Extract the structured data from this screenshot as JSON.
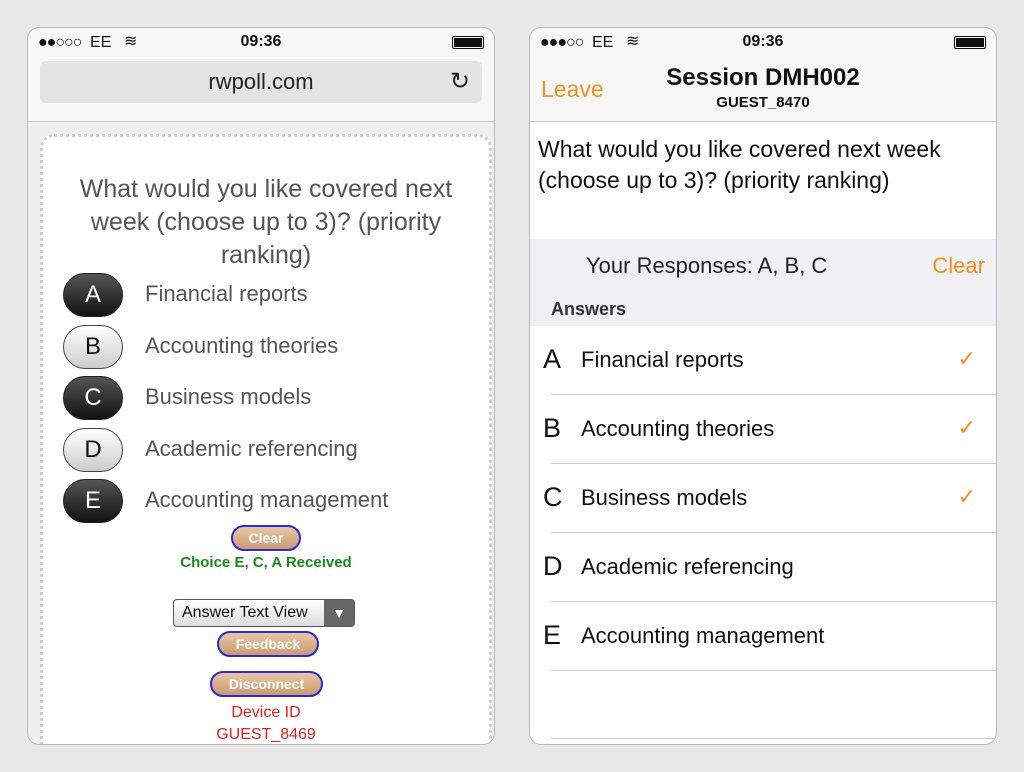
{
  "left": {
    "status": {
      "signal": "●●○○○",
      "carrier": "EE",
      "time": "09:36"
    },
    "url": "rwpoll.com",
    "question": "What would you like covered next week (choose up to 3)? (priority ranking)",
    "options": [
      {
        "letter": "A",
        "text": "Financial reports",
        "selected": true
      },
      {
        "letter": "B",
        "text": "Accounting theories",
        "selected": false
      },
      {
        "letter": "C",
        "text": "Business models",
        "selected": true
      },
      {
        "letter": "D",
        "text": "Academic referencing",
        "selected": false
      },
      {
        "letter": "E",
        "text": "Accounting management",
        "selected": true
      }
    ],
    "clear_label": "Clear",
    "received": "Choice E, C, A Received",
    "view_select": "Answer Text View",
    "feedback_label": "Feedback",
    "disconnect_label": "Disconnect",
    "device_label": "Device ID",
    "device_id": "GUEST_8469"
  },
  "right": {
    "status": {
      "signal": "●●●○○",
      "carrier": "EE",
      "time": "09:36"
    },
    "leave_label": "Leave",
    "title": "Session DMH002",
    "subtitle": "GUEST_8470",
    "question": "What would you like covered next week (choose up to 3)? (priority ranking)",
    "responses": "Your Responses: A, B, C",
    "clear_label": "Clear",
    "answers_header": "Answers",
    "answers": [
      {
        "letter": "A",
        "text": "Financial reports",
        "checked": true
      },
      {
        "letter": "B",
        "text": "Accounting theories",
        "checked": true
      },
      {
        "letter": "C",
        "text": "Business models",
        "checked": true
      },
      {
        "letter": "D",
        "text": "Academic referencing",
        "checked": false
      },
      {
        "letter": "E",
        "text": "Accounting management",
        "checked": false
      }
    ]
  },
  "colors": {
    "accent": "#f5901e",
    "received": "#1a8a1a",
    "device": "#e02020"
  }
}
